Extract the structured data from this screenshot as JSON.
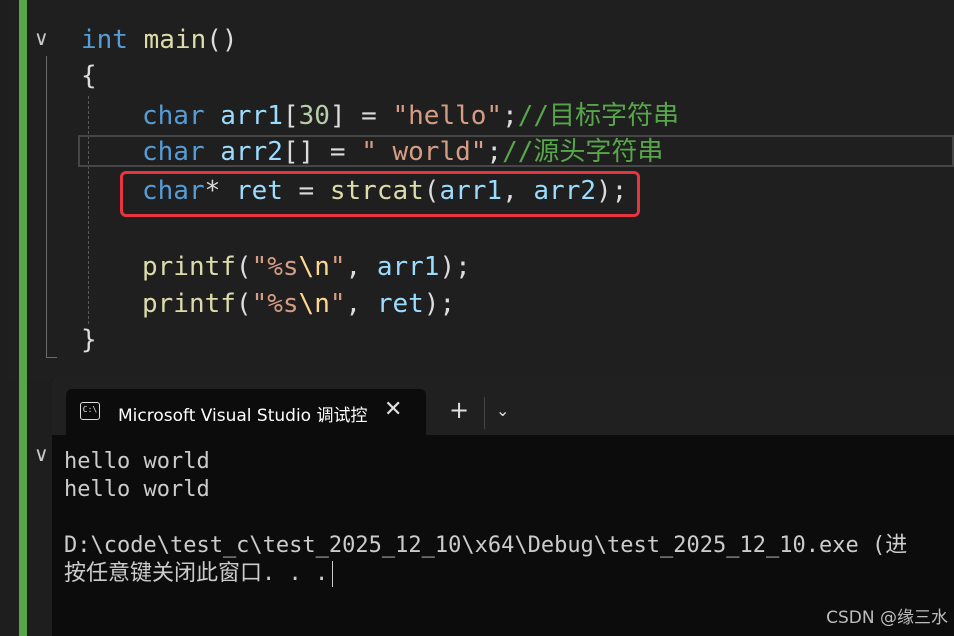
{
  "editor": {
    "lines": {
      "l1": {
        "kw": "int",
        "fn": "main",
        "rest": "()"
      },
      "l2": {
        "text": "{"
      },
      "l3": {
        "kw": "char",
        "var": "arr1",
        "b1": "[",
        "num": "30",
        "b2": "] = ",
        "str": "\"hello\"",
        "semi": ";",
        "cmt": "//目标字符串"
      },
      "l4": {
        "kw": "char",
        "var": "arr2",
        "b1": "[] = ",
        "str": "\" world\"",
        "semi": ";",
        "cmt": "//源头字符串"
      },
      "l5": {
        "kw": "char",
        "star": "* ",
        "var": "ret",
        "eq": " = ",
        "fn": "strcat",
        "p1": "(",
        "a1": "arr1",
        "c": ", ",
        "a2": "arr2",
        "p2": ");"
      },
      "l6": {
        "fn": "printf",
        "p1": "(",
        "s1": "\"%s",
        "esc": "\\n",
        "s2": "\"",
        "c": ", ",
        "var": "arr1",
        "p2": ");"
      },
      "l7": {
        "fn": "printf",
        "p1": "(",
        "s1": "\"%s",
        "esc": "\\n",
        "s2": "\"",
        "c": ", ",
        "var": "ret",
        "p2": ");"
      },
      "l8": {
        "text": "}"
      }
    },
    "fold_icon": "chevron-down-icon"
  },
  "terminal": {
    "tab_title": "Microsoft Visual Studio 调试控",
    "tab_icon": "console-icon",
    "close_label": "✕",
    "new_tab_label": "+",
    "dropdown_label": "⌄",
    "output": [
      "hello world",
      "hello world",
      "",
      "D:\\code\\test_c\\test_2025_12_10\\x64\\Debug\\test_2025_12_10.exe (进",
      "按任意键关闭此窗口. . ."
    ]
  },
  "watermark": "CSDN @缘三水",
  "colors": {
    "highlight_box": "#e8343f",
    "change_bar": "#57a64a"
  }
}
